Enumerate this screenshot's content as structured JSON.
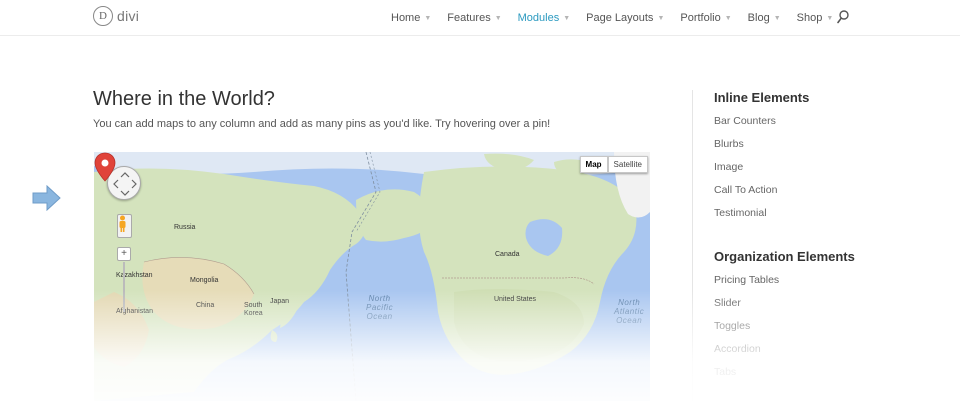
{
  "header": {
    "logo_mark": "D",
    "logo_text": "divi",
    "nav": [
      {
        "label": "Home"
      },
      {
        "label": "Features"
      },
      {
        "label": "Modules"
      },
      {
        "label": "Page Layouts"
      },
      {
        "label": "Portfolio"
      },
      {
        "label": "Blog"
      },
      {
        "label": "Shop"
      }
    ],
    "active_nav": "Modules",
    "active_color": "#2b9ac0",
    "search_icon": "search-icon"
  },
  "main": {
    "title": "Where in the World?",
    "intro": "You can add maps to any column and add as many pins as you'd like. Try hovering over a pin!",
    "map": {
      "type_buttons": [
        "Map",
        "Satellite"
      ],
      "zoom_in": "+",
      "labels": {
        "russia": "Russia",
        "kazakhstan": "Kazakhstan",
        "mongolia": "Mongolia",
        "china": "China",
        "afghanistan": "Afghanistan",
        "south_korea_1": "South",
        "south_korea_2": "Korea",
        "japan": "Japan",
        "canada": "Canada",
        "united_states": "United States",
        "north_pacific": [
          "North",
          "Pacific",
          "Ocean"
        ],
        "north_atlantic": [
          "North",
          "Atlantic",
          "Ocean"
        ]
      },
      "pin_color": "#e0433a",
      "icons": [
        "pan-control-icon",
        "pegman-icon",
        "map-pin-icon"
      ]
    },
    "side_arrow_icon": "arrow-right-icon",
    "side_arrow_color": "#8ab6df"
  },
  "sidebar": {
    "inline_title": "Inline Elements",
    "inline_items": [
      "Bar Counters",
      "Blurbs",
      "Image",
      "Call To Action",
      "Testimonial"
    ],
    "org_title": "Organization Elements",
    "org_items": [
      "Pricing Tables",
      "Slider",
      "Toggles",
      "Accordion",
      "Tabs"
    ]
  }
}
